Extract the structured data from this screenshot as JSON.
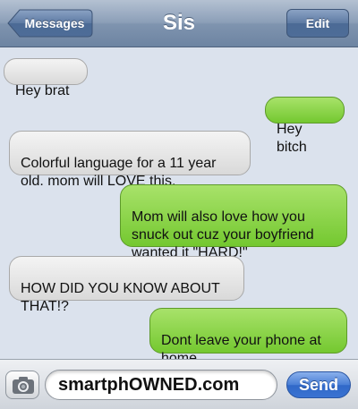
{
  "header": {
    "back_label": "Messages",
    "title": "Sis",
    "edit_label": "Edit"
  },
  "messages": [
    {
      "direction": "received",
      "text": "Hey brat"
    },
    {
      "direction": "sent",
      "text": "Hey bitch"
    },
    {
      "direction": "received",
      "text": "Colorful language for a 11 year\nold. mom will LOVE this."
    },
    {
      "direction": "sent",
      "text": "Mom will also love how you\nsnuck out cuz your boyfriend\nwanted it \"HARD!\""
    },
    {
      "direction": "received",
      "text": "HOW DID YOU KNOW ABOUT\nTHAT!?"
    },
    {
      "direction": "sent",
      "text": "Dont leave your phone at\nhome..."
    }
  ],
  "composer": {
    "input_value": "smartphOWNED.com",
    "send_label": "Send",
    "camera_icon": "camera-icon"
  },
  "colors": {
    "sent_bubble": "#7fcf3a",
    "received_bubble": "#e6e6e6",
    "background": "#dbe2ed",
    "navbar": "#8c9fb8",
    "send_button": "#3a73d2"
  }
}
